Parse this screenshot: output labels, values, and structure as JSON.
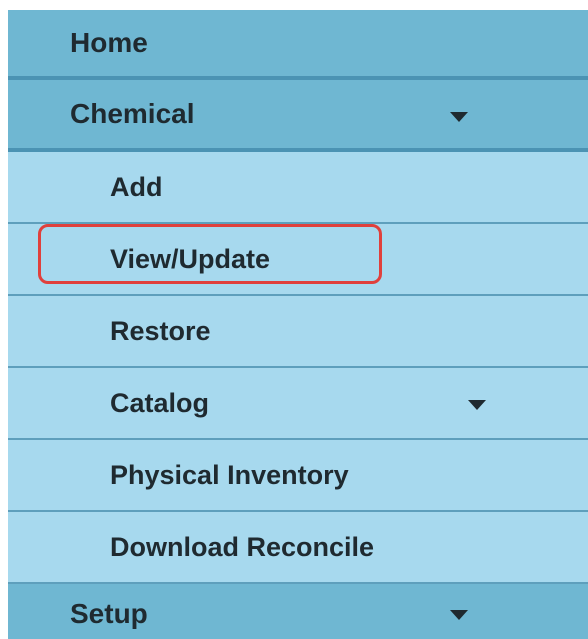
{
  "menu": {
    "home": {
      "label": "Home"
    },
    "chemical": {
      "label": "Chemical",
      "caret_icon": "chevron-down-icon",
      "items": [
        {
          "label": "Add"
        },
        {
          "label": "View/Update",
          "highlighted": true
        },
        {
          "label": "Restore"
        },
        {
          "label": "Catalog",
          "caret_icon": "chevron-down-icon"
        },
        {
          "label": "Physical Inventory"
        },
        {
          "label": "Download Reconcile"
        }
      ]
    },
    "setup": {
      "label": "Setup",
      "caret_icon": "chevron-down-icon"
    }
  },
  "colors": {
    "top_level_bg": "#6fb7d2",
    "sub_level_bg": "#a7d9ee",
    "highlight_border": "#e0403c",
    "text": "#1f2a30"
  }
}
